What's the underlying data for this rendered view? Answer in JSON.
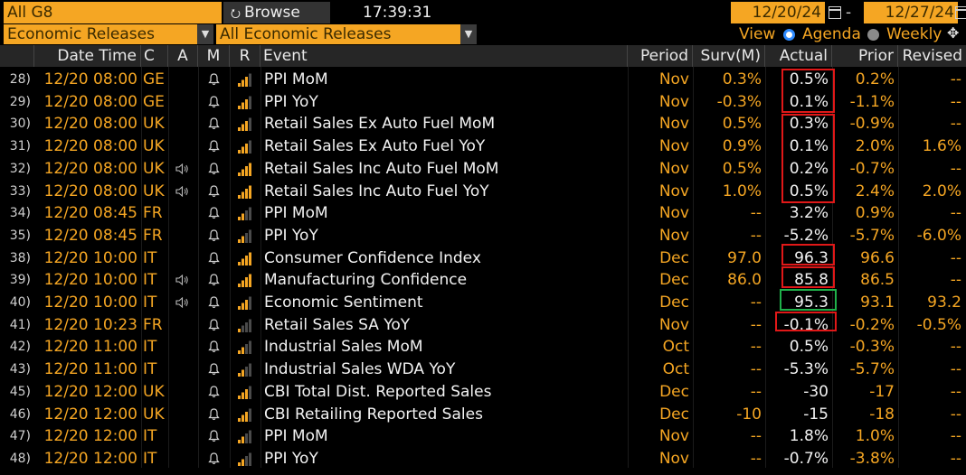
{
  "toolbar": {
    "region": "All G8",
    "browse_label": "Browse",
    "time": "17:39:31",
    "date_from": "12/20/24",
    "date_to": "12/27/24",
    "date_sep": "-",
    "category": "Economic Releases",
    "subcategory": "All Economic Releases",
    "view_label": "View",
    "agenda_label": "Agenda",
    "weekly_label": "Weekly"
  },
  "columns": {
    "datetime": "Date Time",
    "country": "C",
    "alert": "A",
    "my": "M",
    "relevance": "R",
    "event": "Event",
    "period": "Period",
    "survey": "Surv(M)",
    "actual": "Actual",
    "prior": "Prior",
    "revised": "Revised"
  },
  "rows": [
    {
      "idx": "28)",
      "dt": "12/20 08:00",
      "c": "GE",
      "spk": false,
      "bars": 3,
      "event": "PPI MoM",
      "period": "Nov",
      "surv": "0.3%",
      "actual": "0.5%",
      "prior": "0.2%",
      "revised": "--"
    },
    {
      "idx": "29)",
      "dt": "12/20 08:00",
      "c": "GE",
      "spk": false,
      "bars": 3,
      "event": "PPI YoY",
      "period": "Nov",
      "surv": "-0.3%",
      "actual": "0.1%",
      "prior": "-1.1%",
      "revised": "--"
    },
    {
      "idx": "30)",
      "dt": "12/20 08:00",
      "c": "UK",
      "spk": false,
      "bars": 3,
      "event": "Retail Sales Ex Auto Fuel MoM",
      "period": "Nov",
      "surv": "0.5%",
      "actual": "0.3%",
      "prior": "-0.9%",
      "revised": "--"
    },
    {
      "idx": "31)",
      "dt": "12/20 08:00",
      "c": "UK",
      "spk": false,
      "bars": 3,
      "event": "Retail Sales Ex Auto Fuel YoY",
      "period": "Nov",
      "surv": "0.9%",
      "actual": "0.1%",
      "prior": "2.0%",
      "revised": "1.6%"
    },
    {
      "idx": "32)",
      "dt": "12/20 08:00",
      "c": "UK",
      "spk": true,
      "bars": 4,
      "event": "Retail Sales Inc Auto Fuel MoM",
      "period": "Nov",
      "surv": "0.5%",
      "actual": "0.2%",
      "prior": "-0.7%",
      "revised": "--"
    },
    {
      "idx": "33)",
      "dt": "12/20 08:00",
      "c": "UK",
      "spk": true,
      "bars": 4,
      "event": "Retail Sales Inc Auto Fuel YoY",
      "period": "Nov",
      "surv": "1.0%",
      "actual": "0.5%",
      "prior": "2.4%",
      "revised": "2.0%"
    },
    {
      "idx": "34)",
      "dt": "12/20 08:45",
      "c": "FR",
      "spk": false,
      "bars": 2,
      "event": "PPI MoM",
      "period": "Nov",
      "surv": "--",
      "actual": "3.2%",
      "prior": "0.9%",
      "revised": "--"
    },
    {
      "idx": "35)",
      "dt": "12/20 08:45",
      "c": "FR",
      "spk": false,
      "bars": 2,
      "event": "PPI YoY",
      "period": "Nov",
      "surv": "--",
      "actual": "-5.2%",
      "prior": "-5.7%",
      "revised": "-6.0%"
    },
    {
      "idx": "38)",
      "dt": "12/20 10:00",
      "c": "IT",
      "spk": false,
      "bars": 4,
      "event": "Consumer Confidence Index",
      "period": "Dec",
      "surv": "97.0",
      "actual": "96.3",
      "prior": "96.6",
      "revised": "--"
    },
    {
      "idx": "39)",
      "dt": "12/20 10:00",
      "c": "IT",
      "spk": true,
      "bars": 4,
      "event": "Manufacturing Confidence",
      "period": "Dec",
      "surv": "86.0",
      "actual": "85.8",
      "prior": "86.5",
      "revised": "--"
    },
    {
      "idx": "40)",
      "dt": "12/20 10:00",
      "c": "IT",
      "spk": true,
      "bars": 3,
      "event": "Economic Sentiment",
      "period": "Dec",
      "surv": "--",
      "actual": "95.3",
      "prior": "93.1",
      "revised": "93.2"
    },
    {
      "idx": "41)",
      "dt": "12/20 10:23",
      "c": "FR",
      "spk": false,
      "bars": 1,
      "event": "Retail Sales SA YoY",
      "period": "Nov",
      "surv": "--",
      "actual": "-0.1%",
      "prior": "-0.2%",
      "revised": "-0.5%"
    },
    {
      "idx": "42)",
      "dt": "12/20 11:00",
      "c": "IT",
      "spk": false,
      "bars": 2,
      "event": "Industrial Sales MoM",
      "period": "Oct",
      "surv": "--",
      "actual": "0.5%",
      "prior": "-0.3%",
      "revised": "--"
    },
    {
      "idx": "43)",
      "dt": "12/20 11:00",
      "c": "IT",
      "spk": false,
      "bars": 2,
      "event": "Industrial Sales WDA YoY",
      "period": "Oct",
      "surv": "--",
      "actual": "-5.3%",
      "prior": "-5.7%",
      "revised": "--"
    },
    {
      "idx": "45)",
      "dt": "12/20 12:00",
      "c": "UK",
      "spk": false,
      "bars": 3,
      "event": "CBI Total Dist. Reported Sales",
      "period": "Dec",
      "surv": "--",
      "actual": "-30",
      "prior": "-17",
      "revised": "--"
    },
    {
      "idx": "46)",
      "dt": "12/20 12:00",
      "c": "UK",
      "spk": false,
      "bars": 3,
      "event": "CBI Retailing Reported Sales",
      "period": "Dec",
      "surv": "-10",
      "actual": "-15",
      "prior": "-18",
      "revised": "--"
    },
    {
      "idx": "47)",
      "dt": "12/20 12:00",
      "c": "IT",
      "spk": false,
      "bars": 2,
      "event": "PPI MoM",
      "period": "Nov",
      "surv": "--",
      "actual": "1.8%",
      "prior": "1.0%",
      "revised": "--"
    },
    {
      "idx": "48)",
      "dt": "12/20 12:00",
      "c": "IT",
      "spk": false,
      "bars": 2,
      "event": "PPI YoY",
      "period": "Nov",
      "surv": "--",
      "actual": "-0.7%",
      "prior": "-3.8%",
      "revised": "--"
    }
  ],
  "highlight_colors": {
    "red": "#e01818",
    "green": "#1fb14a"
  },
  "accent": "#f5a623"
}
